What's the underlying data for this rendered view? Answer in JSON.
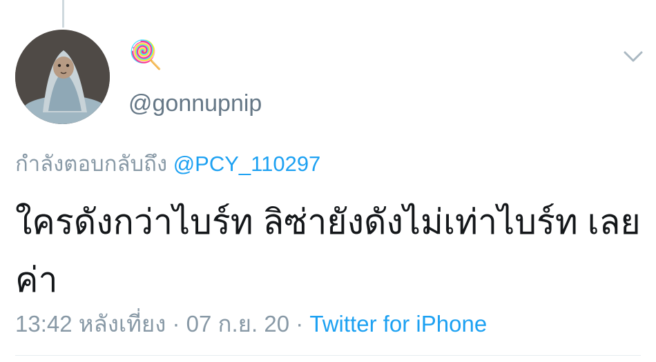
{
  "tweet": {
    "display_name": "🍭",
    "handle": "@gonnupnip",
    "reply_prefix": "กำลังตอบกลับถึง ",
    "reply_to": "@PCY_110297",
    "text": "ใครดังกว่าไบร์ท ลิซ่ายังดังไม่เท่าไบร์ท เลยค่า",
    "time": "13:42 หลังเที่ยง",
    "separator1": " · ",
    "date": "07 ก.ย. 20",
    "separator2": " · ",
    "source": "Twitter for iPhone"
  },
  "colors": {
    "link": "#1da1f2",
    "secondary_text": "#8899a6",
    "primary_text": "#14171a"
  }
}
